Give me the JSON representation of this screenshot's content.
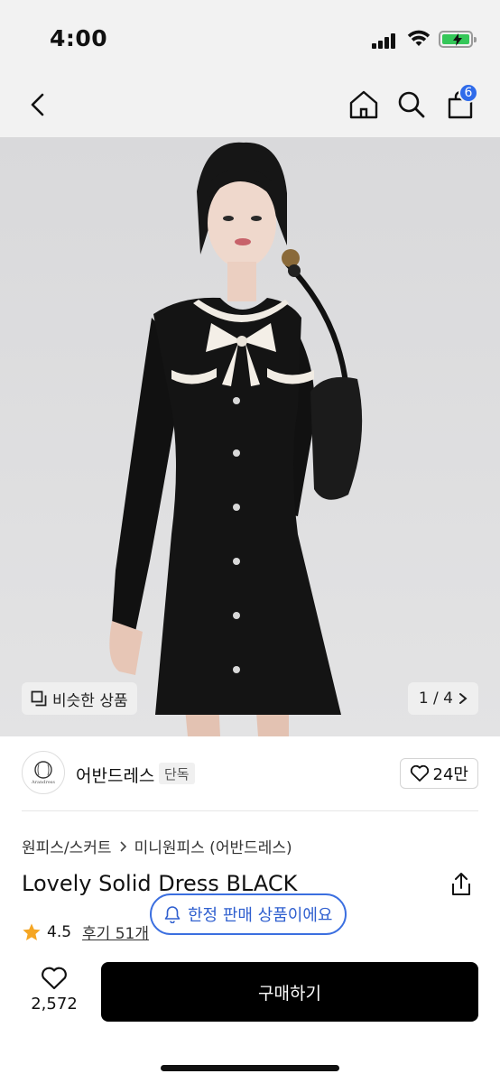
{
  "status_bar": {
    "time": "4:00"
  },
  "nav": {
    "cart_count": "6"
  },
  "hero": {
    "similar_label": "비슷한 상품",
    "page_indicator": "1 / 4"
  },
  "seller": {
    "name": "어반드레스",
    "logo_text": "Arandress",
    "tag": "단독",
    "like_count": "24만"
  },
  "breadcrumb": {
    "category": "원피스/스커트",
    "subcategory": "미니원피스 (어반드레스)"
  },
  "product": {
    "title": "Lovely Solid Dress BLACK",
    "rating": "4.5",
    "reviews": "후기 51개"
  },
  "toast": {
    "text": "한정 판매 상품이에요"
  },
  "bottom_bar": {
    "wish_count": "2,572",
    "buy_label": "구매하기"
  },
  "colors": {
    "accent": "#2f6bea",
    "star": "#f5a623",
    "battery": "#35c759"
  }
}
